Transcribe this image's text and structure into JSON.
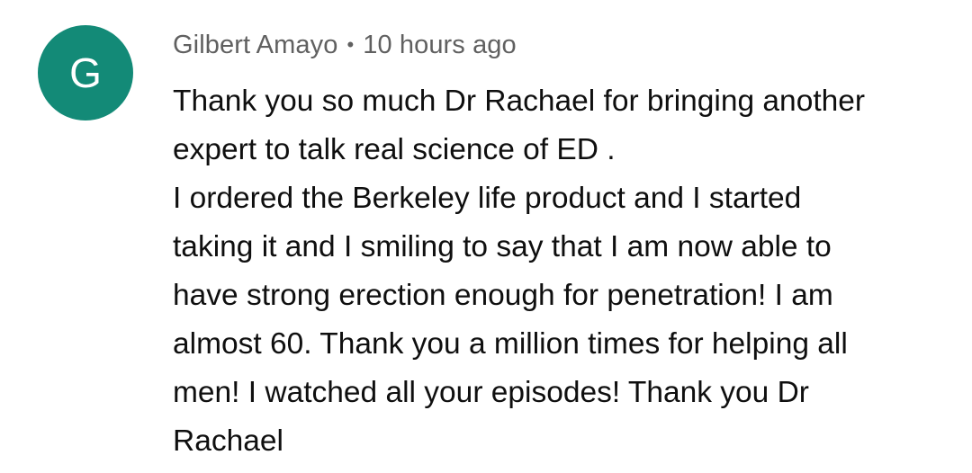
{
  "comment": {
    "avatar_letter": "G",
    "avatar_color": "#138a77",
    "author": "Gilbert Amayo",
    "separator": "•",
    "timestamp": "10 hours ago",
    "lines": [
      "Thank you so much Dr Rachael for bringing another",
      "expert to talk real science of ED .",
      "I ordered the Berkeley life product and I started",
      "taking it and I smiling to say that I am now able to",
      "have strong erection enough for penetration! I am",
      "almost 60. Thank you a million times for helping all",
      "men! I watched all your episodes! Thank you Dr",
      "Rachael"
    ]
  }
}
